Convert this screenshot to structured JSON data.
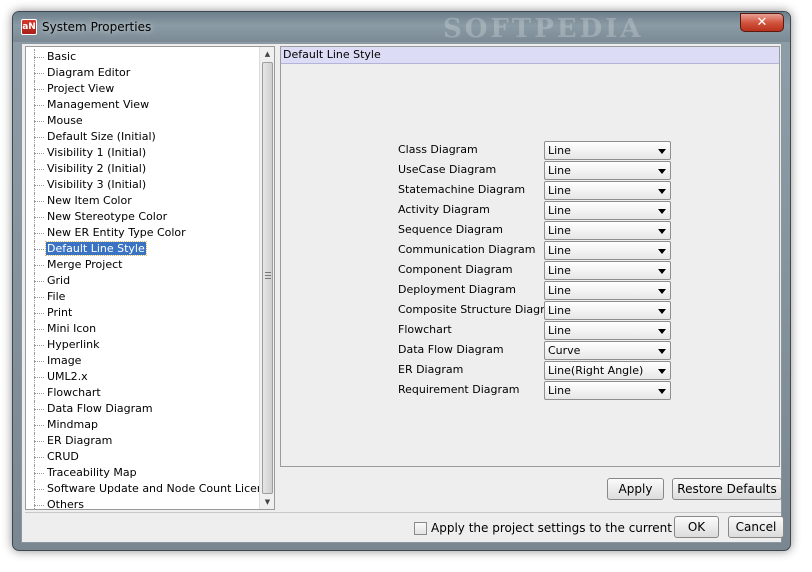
{
  "window": {
    "title": "System Properties",
    "app_icon_glyph": "aN",
    "watermark": "SOFTPEDIA",
    "close_glyph": "✕"
  },
  "sidebar": {
    "selected_index": 12,
    "items": [
      "Basic",
      "Diagram Editor",
      "Project View",
      "Management View",
      "Mouse",
      "Default Size (Initial)",
      "Visibility 1 (Initial)",
      "Visibility 2 (Initial)",
      "Visibility 3 (Initial)",
      "New Item Color",
      "New Stereotype Color",
      "New ER Entity Type Color",
      "Default Line Style",
      "Merge Project",
      "Grid",
      "File",
      "Print",
      "Mini Icon",
      "Hyperlink",
      "Image",
      "UML2.x",
      "Flowchart",
      "Data Flow Diagram",
      "Mindmap",
      "ER Diagram",
      "CRUD",
      "Traceability Map",
      "Software Update and Node Count License",
      "Others"
    ]
  },
  "panel": {
    "header": "Default Line Style",
    "rows": [
      {
        "label": "Class Diagram",
        "value": "Line"
      },
      {
        "label": "UseCase Diagram",
        "value": "Line"
      },
      {
        "label": "Statemachine Diagram",
        "value": "Line"
      },
      {
        "label": "Activity Diagram",
        "value": "Line"
      },
      {
        "label": "Sequence Diagram",
        "value": "Line"
      },
      {
        "label": "Communication Diagram",
        "value": "Line"
      },
      {
        "label": "Component Diagram",
        "value": "Line"
      },
      {
        "label": "Deployment Diagram",
        "value": "Line"
      },
      {
        "label": "Composite Structure Diagram",
        "value": "Line"
      },
      {
        "label": "Flowchart",
        "value": "Line"
      },
      {
        "label": "Data Flow Diagram",
        "value": "Curve"
      },
      {
        "label": "ER Diagram",
        "value": "Line(Right Angle)"
      },
      {
        "label": "Requirement Diagram",
        "value": "Line"
      }
    ],
    "apply_label": "Apply",
    "restore_label": "Restore Defaults"
  },
  "footer": {
    "checkbox_label": "Apply the project settings to the current project",
    "checkbox_checked": false,
    "ok_label": "OK",
    "cancel_label": "Cancel"
  },
  "colors": {
    "selection": "#3a72c4",
    "section_header": "#dcdcf6",
    "title_bar": "#7b8a94"
  }
}
